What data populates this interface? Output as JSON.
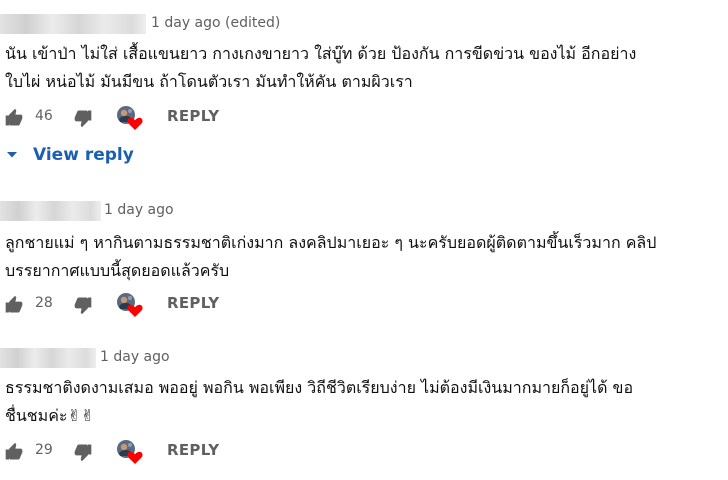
{
  "comments": [
    {
      "time": "1 day ago (edited)",
      "lines": [
        "นัน เข้าป่า ไม่ใส่ เสื้อแขนยาว กางเกงขายาว ใส่บู๊ท ด้วย ป้องกัน การขีดข่วน ของไม้ อีกอย่าง",
        "ใบไผ่ หน่อไม้ มันมีขน ถ้าโดนตัวเรา มันทำให้คัน ตามผิวเรา"
      ],
      "likes": "46",
      "reply_label": "REPLY"
    },
    {
      "time": "1 day ago",
      "lines": [
        "ลูกชายแม่ ๆ หากินตามธรรมชาติเก่งมาก ลงคลิปมาเยอะ ๆ นะครับยอดผู้ติดตามขึ้นเร็วมาก คลิป",
        "บรรยากาศแบบนี้สุดยอดแล้วครับ"
      ],
      "likes": "28",
      "reply_label": "REPLY"
    },
    {
      "time": "1 day ago",
      "lines": [
        "ธรรมชาติงดงามเสมอ พออยู่ พอกิน พอเพียง วิถีชีวิตเรียบง่าย ไม่ต้องมีเงินมากมายก็อยู่ได้ ขอ",
        "ชื่นชมค่ะ✌✌"
      ],
      "likes": "29",
      "reply_label": "REPLY"
    }
  ],
  "view_reply_label": "View reply",
  "icons": {
    "like": "thumbs-up-icon",
    "dislike": "thumbs-down-icon",
    "creator_heart": "creator-heart-icon",
    "expand": "caret-down-icon"
  },
  "colors": {
    "link": "#1a5fb4",
    "heart": "#ff0000",
    "secondary_text": "#606060",
    "icon": "#606060"
  }
}
